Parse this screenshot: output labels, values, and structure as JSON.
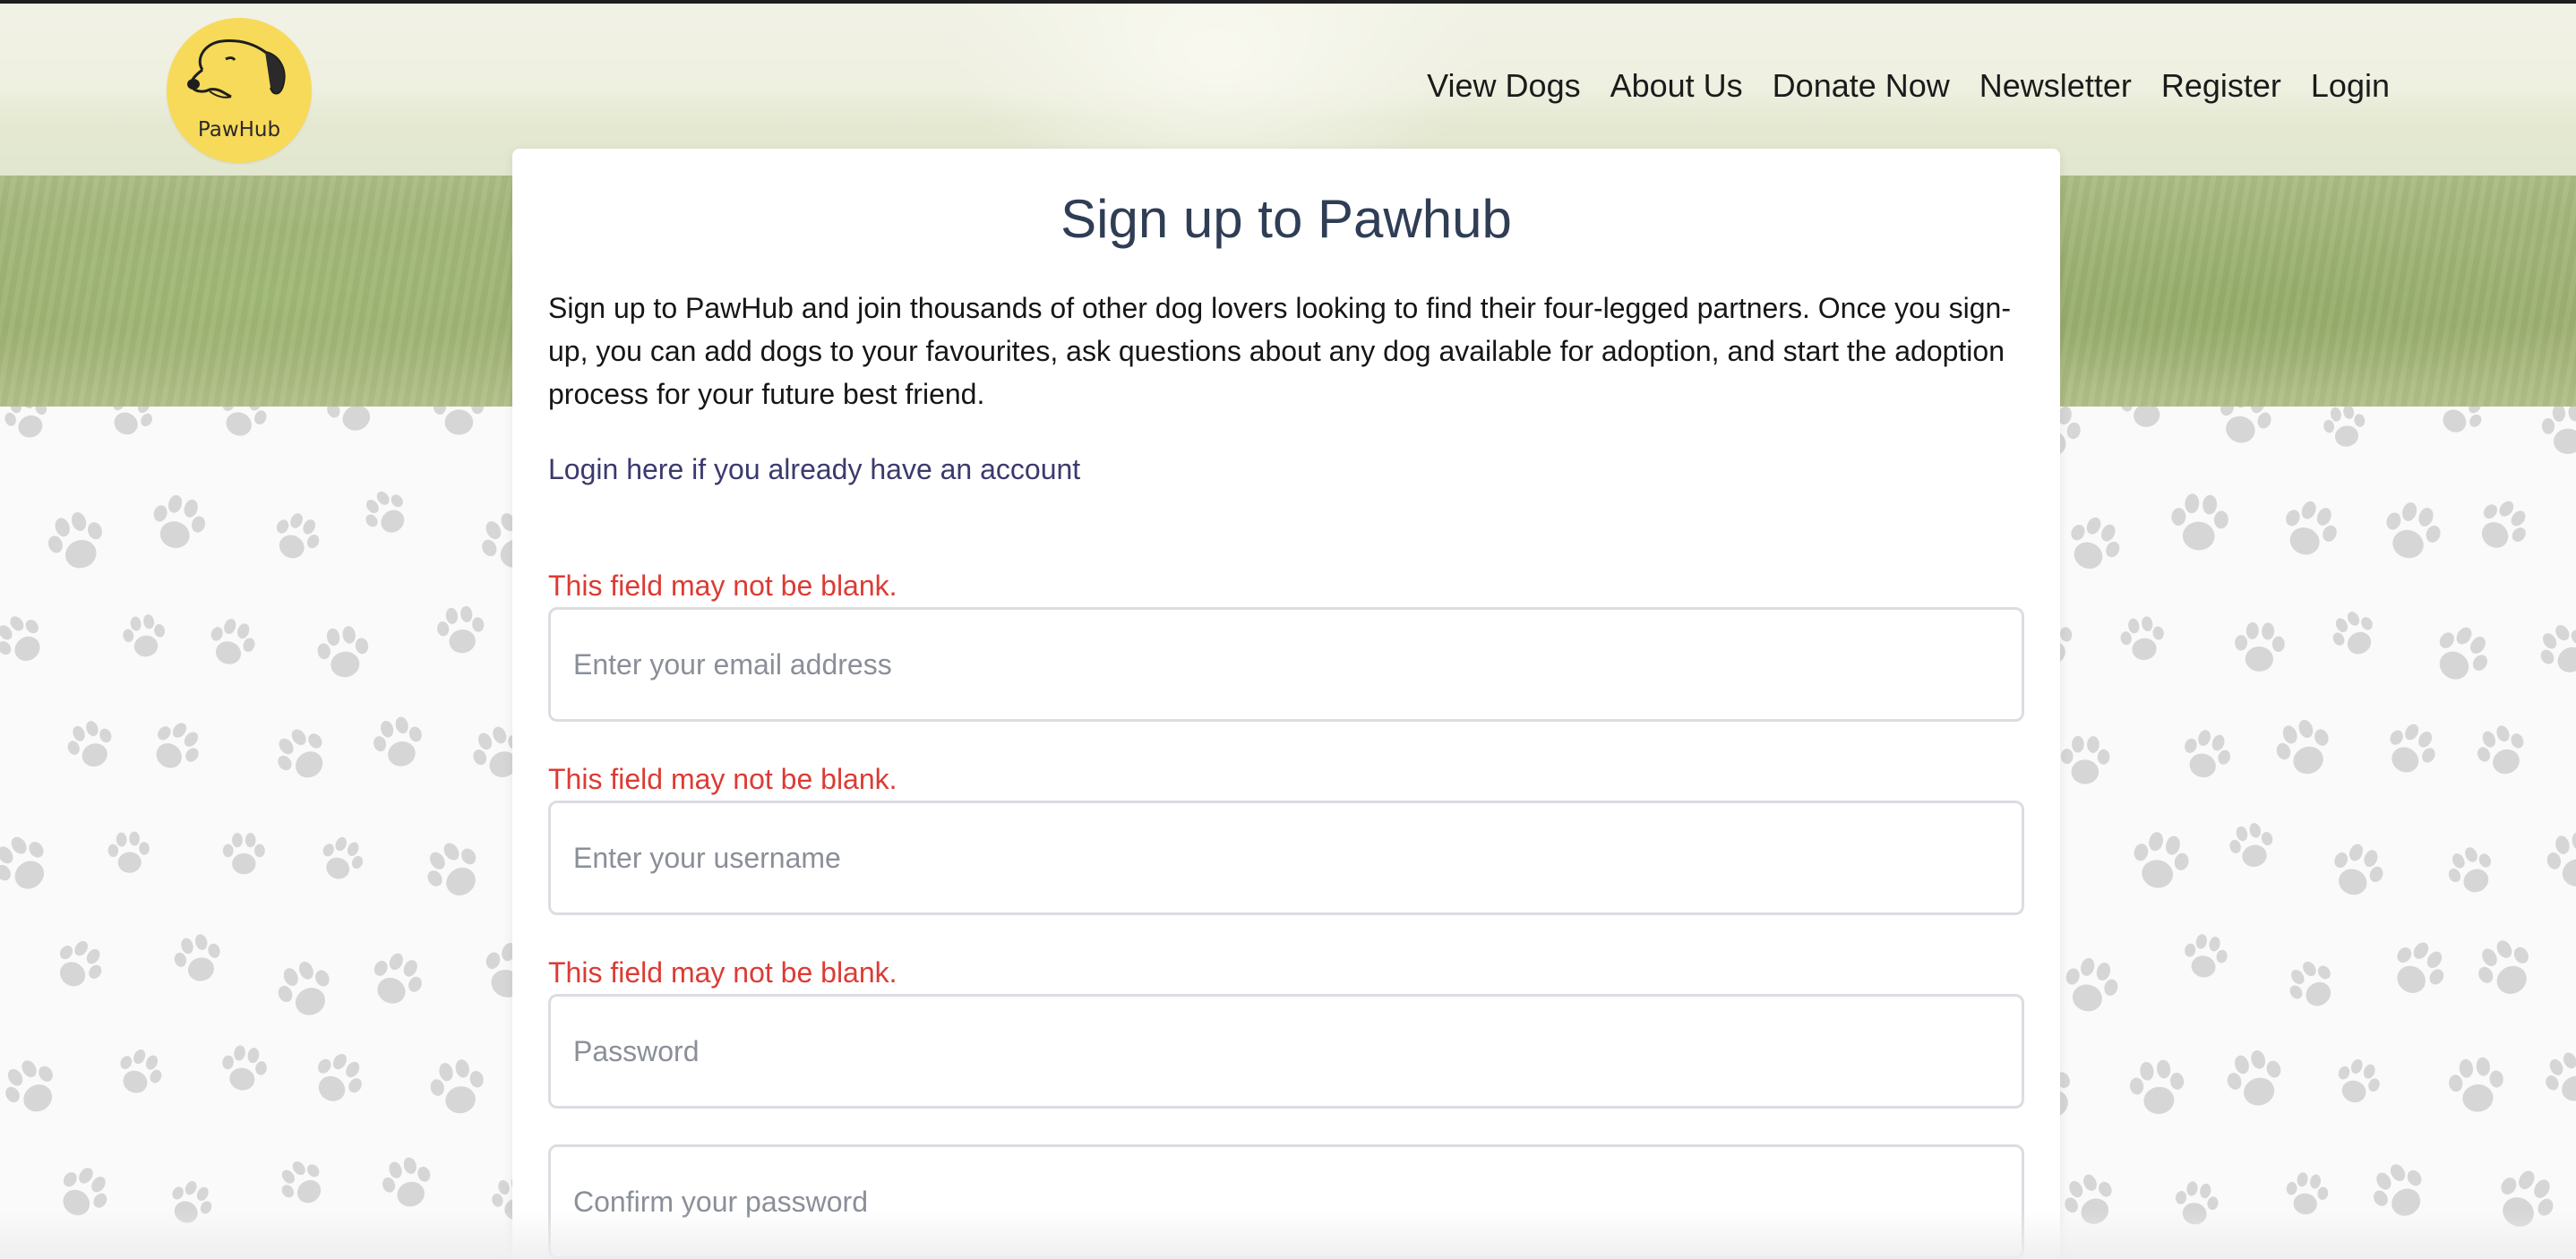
{
  "brand": {
    "logo_text": "PawHub"
  },
  "nav": {
    "items": [
      "View Dogs",
      "About Us",
      "Donate Now",
      "Newsletter",
      "Register",
      "Login"
    ]
  },
  "signup": {
    "title": "Sign up to Pawhub",
    "intro": "Sign up to PawHub and join thousands of other dog lovers looking to find their four-legged partners. Once you sign-up, you can add dogs to your favourites, ask questions about any dog available for adoption, and start the adoption process for your future best friend.",
    "login_link": "Login here if you already have an account",
    "fields": [
      {
        "error": "This field may not be blank.",
        "placeholder": "Enter your email address",
        "value": ""
      },
      {
        "error": "This field may not be blank.",
        "placeholder": "Enter your username",
        "value": ""
      },
      {
        "error": "This field may not be blank.",
        "placeholder": "Password",
        "value": ""
      },
      {
        "error": "",
        "placeholder": "Confirm your password",
        "value": ""
      }
    ]
  },
  "colors": {
    "logo_bg": "#f7da5a",
    "title": "#2f3d55",
    "link": "#3b3a6e",
    "error": "#dc3b34",
    "field_border": "#dadde2",
    "paw": "#d6d6d6"
  },
  "icons": {
    "logo": "dog-head-icon",
    "background": "paw-print-icon"
  }
}
